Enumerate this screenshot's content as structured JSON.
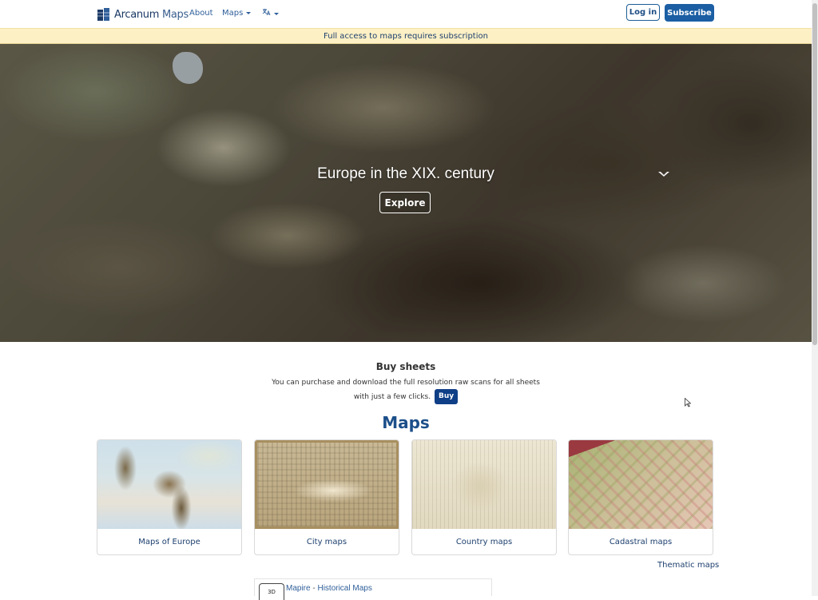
{
  "navbar": {
    "brand_name": "Arcanum",
    "brand_sub": "Maps",
    "links": {
      "about": "About",
      "maps": "Maps"
    },
    "language_icon": "translate-icon",
    "login_label": "Log in",
    "subscribe_label": "Subscribe"
  },
  "banner": {
    "text": "Full access to maps requires subscription"
  },
  "hero": {
    "title": "Europe in the XIX. century",
    "explore_label": "Explore"
  },
  "buy": {
    "title": "Buy sheets",
    "text": "You can purchase and download the full resolution raw scans for all sheets with just a few clicks.",
    "button_label": "Buy"
  },
  "maps": {
    "heading": "Maps",
    "cards": [
      {
        "label": "Maps of Europe"
      },
      {
        "label": "City maps"
      },
      {
        "label": "Country maps"
      },
      {
        "label": "Cadastral maps"
      }
    ],
    "thematic_label": "Thematic maps"
  },
  "mapire": {
    "icon_text": "3D",
    "name": "Mapire",
    "separator": " - ",
    "subtitle": "Historical Maps"
  },
  "colors": {
    "primary": "#1b5ea3",
    "banner_bg": "#fdf0c5",
    "buy_button": "#0f3f86",
    "link": "#1c3f6e"
  }
}
